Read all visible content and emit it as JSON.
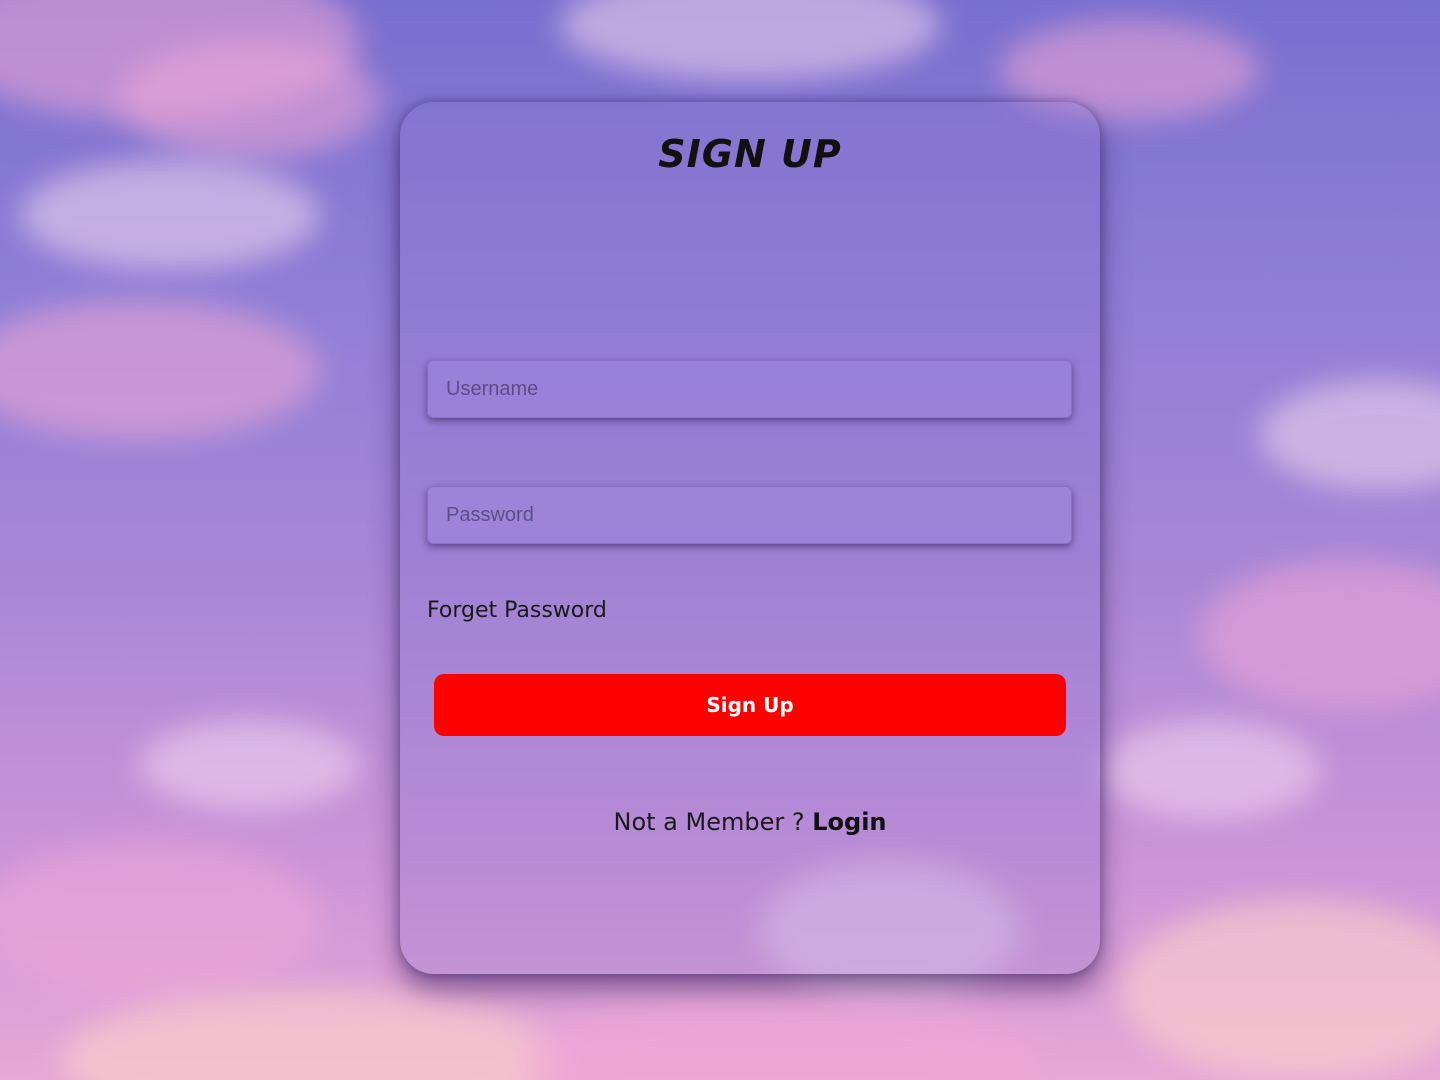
{
  "page": {
    "background_colors": [
      "#7a6fcf",
      "#a786d6",
      "#e8a7d6"
    ]
  },
  "form": {
    "title": "SIGN UP",
    "username_placeholder": "Username",
    "password_placeholder": "Password",
    "forget_password": "Forget Password",
    "submit_label": "Sign Up",
    "submit_color": "#ff0000",
    "member_text": "Not a Member ?",
    "login_link": "Login"
  }
}
